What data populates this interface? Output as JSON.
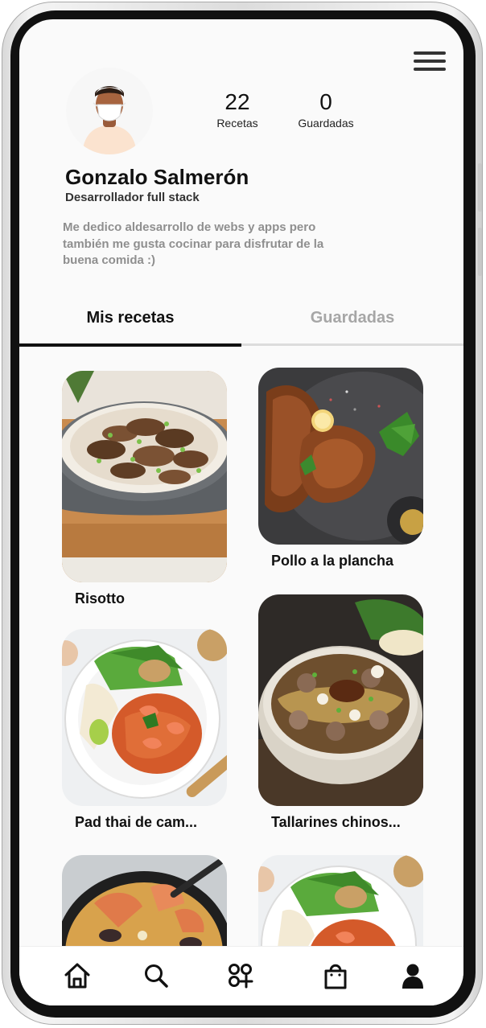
{
  "profile": {
    "name": "Gonzalo Salmerón",
    "role": "Desarrollador full stack",
    "bio_lines": [
      "Me dedico aldesarrollo de webs y apps pero",
      "también me gusta cocinar para disfrutar de la",
      "buena comida :)"
    ],
    "avatar_icon": "masked-person-avatar"
  },
  "stats": {
    "recipes": {
      "value": "22",
      "label": "Recetas"
    },
    "saved": {
      "value": "0",
      "label": "Guardadas"
    }
  },
  "tabs": [
    {
      "label": "Mis recetas",
      "active": true
    },
    {
      "label": "Guardadas",
      "active": false
    }
  ],
  "recipes": [
    {
      "title": "Risotto",
      "image": "mushroom-risotto-photo"
    },
    {
      "title": "Pollo a la plancha",
      "image": "grilled-chicken-photo"
    },
    {
      "title": "Pad thai de cam...",
      "image": "shrimp-pad-thai-photo"
    },
    {
      "title": "Tallarines chinos...",
      "image": "noodle-bowl-photo"
    },
    {
      "title": "",
      "image": "seafood-paella-photo"
    },
    {
      "title": "",
      "image": "shrimp-pad-thai-photo"
    }
  ],
  "bottom_nav": [
    {
      "icon": "home-icon"
    },
    {
      "icon": "search-icon"
    },
    {
      "icon": "apps-add-icon"
    },
    {
      "icon": "shopping-bag-icon"
    },
    {
      "icon": "user-icon"
    }
  ],
  "colors": {
    "screen_background": "#fafafa",
    "text_primary": "#111111",
    "text_muted": "#8f8f8f",
    "tab_inactive": "#a6a6a6",
    "tab_indicator": "#111111"
  }
}
